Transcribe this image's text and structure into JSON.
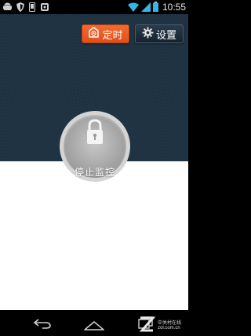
{
  "status_bar": {
    "time": "10:55",
    "icons": [
      "android-icon",
      "shield-icon",
      "phone-icon",
      "gamepad-icon",
      "wifi-icon",
      "signal-icon",
      "battery-icon"
    ]
  },
  "toolbar": {
    "timer_label": "定时",
    "settings_label": "设置"
  },
  "monitor": {
    "label": "停止监控"
  },
  "nav": {
    "icons": [
      "back-icon",
      "home-icon",
      "recent-apps-icon"
    ]
  },
  "watermark": {
    "line1": "中关村在线",
    "line2": "zol.com.cn"
  },
  "colors": {
    "top_panel": "#1c3040",
    "timer_button": "#f05a22",
    "settings_button": "#1f2f3d",
    "lock_ring": "#d4d4d4",
    "lock_center": "#a8a8a8"
  }
}
